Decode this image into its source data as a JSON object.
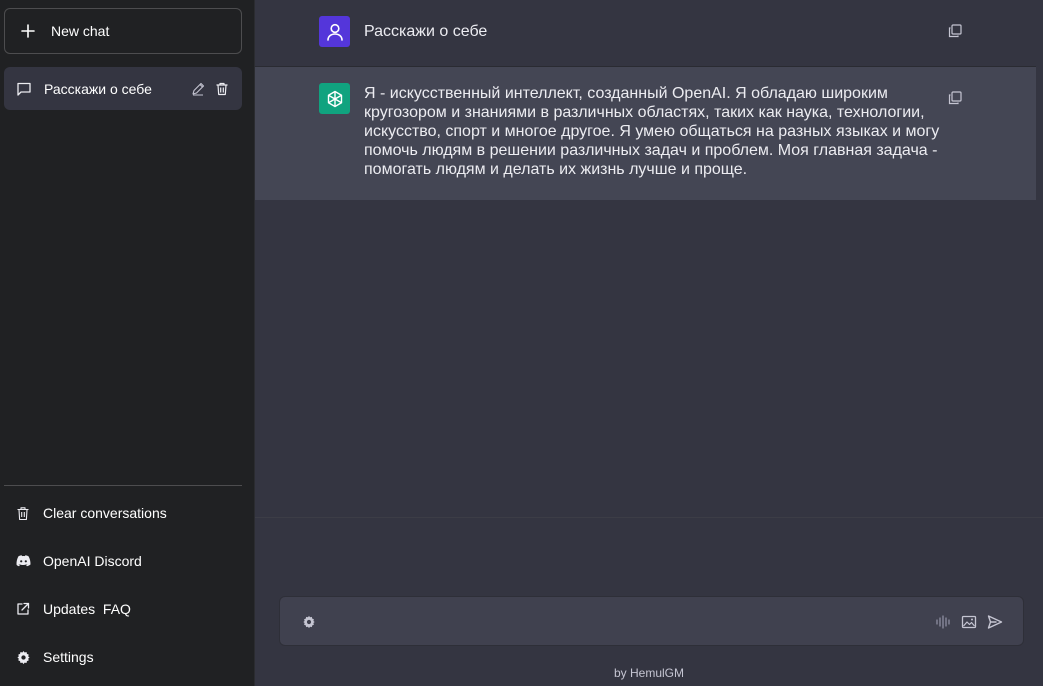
{
  "sidebar": {
    "new_chat_label": "New chat",
    "chats": [
      {
        "title": "Расскажи о себе"
      }
    ],
    "bottom_items": [
      {
        "label": "Clear conversations",
        "icon": "trash-icon"
      },
      {
        "label": "OpenAI Discord",
        "icon": "discord-icon"
      },
      {
        "label": "Updates  FAQ",
        "icon": "external-link-icon"
      },
      {
        "label": "Settings",
        "icon": "gear-icon"
      }
    ]
  },
  "conversation": {
    "messages": [
      {
        "role": "user",
        "text": "Расскажи о себе"
      },
      {
        "role": "assistant",
        "text": "Я - искусственный интеллект, созданный OpenAI. Я обладаю широким кругозором и знаниями в различных областях, таких как наука, технологии, искусство, спорт и многое другое. Я умею общаться на разных языках и могу помочь людям в решении различных задач и проблем. Моя главная задача - помогать людям и делать их жизнь лучше и проще."
      }
    ]
  },
  "input": {
    "value": "",
    "placeholder": ""
  },
  "footer": {
    "credit": "by HemulGM"
  },
  "colors": {
    "sidebar_bg": "#202123",
    "main_bg": "#343541",
    "assistant_row_bg": "#444654",
    "user_avatar": "#5436da",
    "assistant_avatar": "#10a37f"
  }
}
